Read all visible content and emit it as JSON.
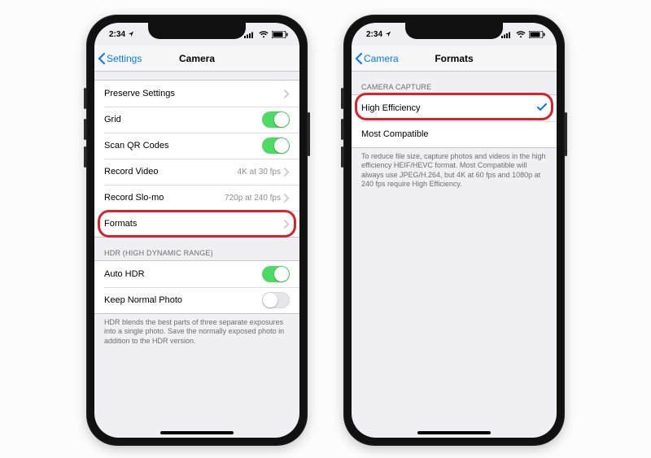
{
  "status": {
    "time": "2:34",
    "loc_icon": "location"
  },
  "left": {
    "back": "Settings",
    "title": "Camera",
    "rows": {
      "preserve": "Preserve Settings",
      "grid": "Grid",
      "scanqr": "Scan QR Codes",
      "record_video": "Record Video",
      "record_video_detail": "4K at 30 fps",
      "record_slomo": "Record Slo-mo",
      "record_slomo_detail": "720p at 240 fps",
      "formats": "Formats"
    },
    "hdr_header": "HDR (HIGH DYNAMIC RANGE)",
    "auto_hdr": "Auto HDR",
    "keep_normal": "Keep Normal Photo",
    "hdr_footer": "HDR blends the best parts of three separate exposures into a single photo. Save the normally exposed photo in addition to the HDR version."
  },
  "right": {
    "back": "Camera",
    "title": "Formats",
    "section_header": "CAMERA CAPTURE",
    "high_efficiency": "High Efficiency",
    "most_compatible": "Most Compatible",
    "footer": "To reduce file size, capture photos and videos in the high efficiency HEIF/HEVC format. Most Compatible will always use JPEG/H.264, but 4K at 60 fps and 1080p at 240 fps require High Efficiency."
  }
}
